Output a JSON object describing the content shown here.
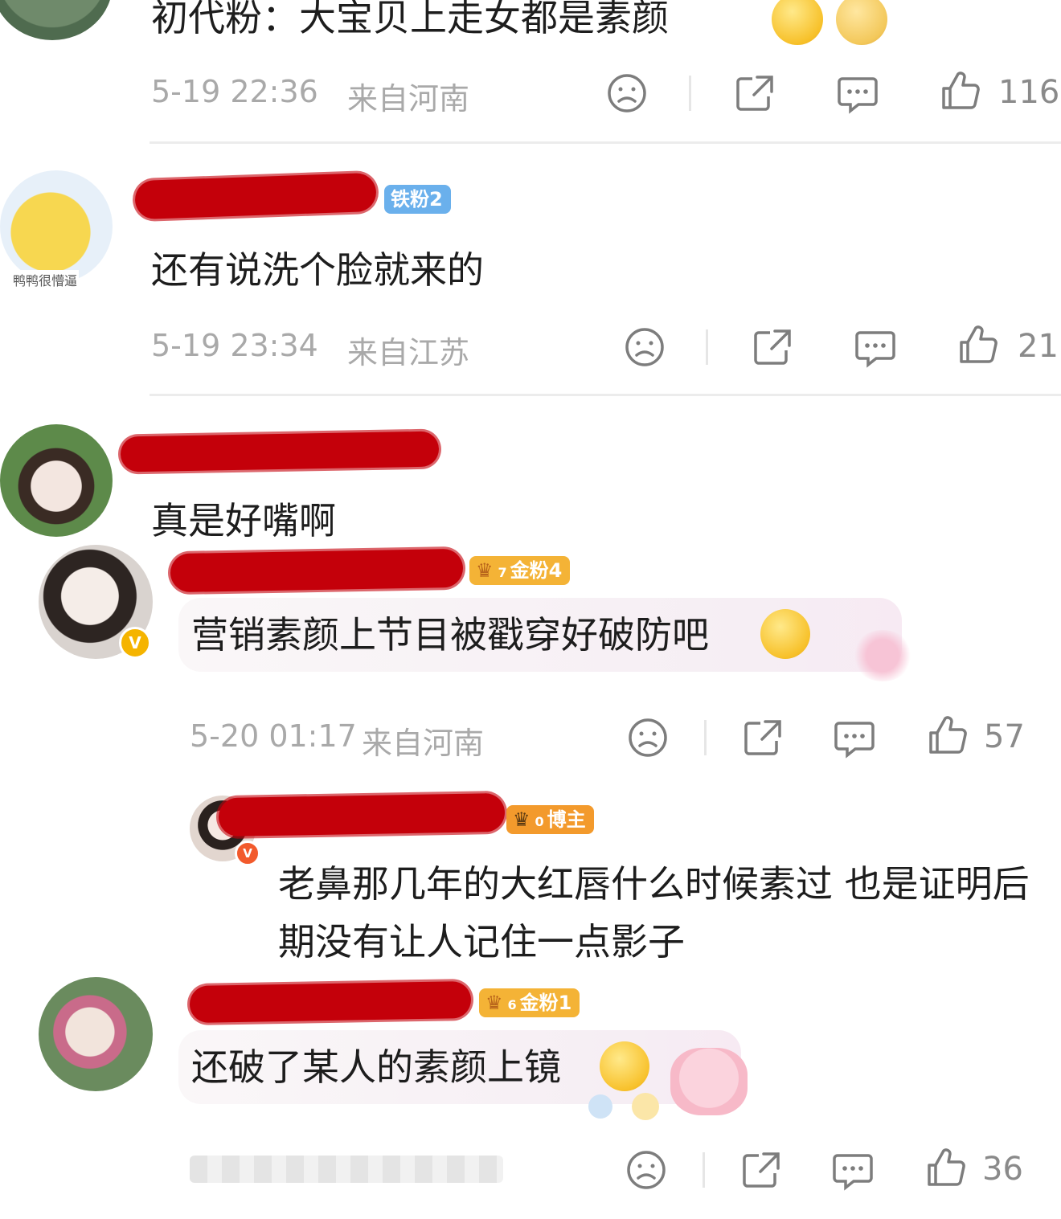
{
  "comments": [
    {
      "text": "初代粉：大宝贝上走女都是素颜",
      "date": "5-19 22:36",
      "location": "来自河南",
      "likes": "116"
    },
    {
      "avatar_caption": "鸭鸭很懵逼",
      "badge": "铁粉2",
      "text": "还有说洗个脸就来的",
      "date": "5-19 23:34",
      "location": "来自江苏",
      "likes": "21"
    },
    {
      "text": "真是好嘴啊"
    },
    {
      "badge": "金粉4",
      "badge_level": "7",
      "text": "营销素颜上节目被戳穿好破防吧",
      "date": "5-20 01:17",
      "location": "来自河南",
      "likes": "57"
    },
    {
      "badge": "博主",
      "badge_level": "0",
      "text": "老鼻那几年的大红唇什么时候素过 也是证明后期没有让人记住一点影子"
    },
    {
      "badge": "金粉1",
      "badge_level": "6",
      "text": "还破了某人的素颜上镜",
      "likes": "36"
    }
  ],
  "icons": {
    "dislike": "frown-face-icon",
    "share": "share-icon",
    "comment": "comment-bubble-icon",
    "like": "thumbs-up-icon",
    "verified": "v-badge-icon"
  },
  "colors": {
    "redaction": "#c4000a",
    "badge_blue": "#6ab0ec",
    "badge_gold": "#f4b336",
    "verified": "#f5b400"
  }
}
